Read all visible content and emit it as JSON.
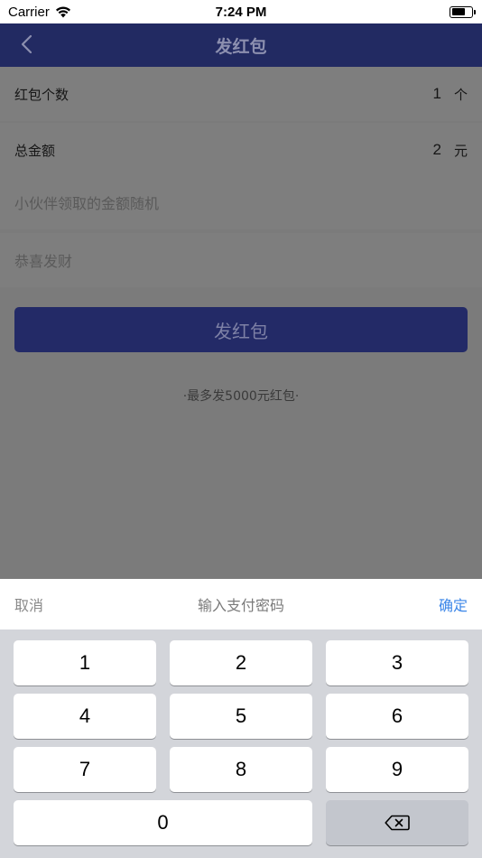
{
  "status_bar": {
    "carrier": "Carrier",
    "time": "7:24 PM"
  },
  "nav": {
    "title": "发红包"
  },
  "form": {
    "count_label": "红包个数",
    "count_value": "1",
    "count_unit": "个",
    "amount_label": "总金额",
    "amount_value": "2",
    "amount_unit": "元",
    "random_hint": "小伙伴领取的金额随机",
    "greeting_placeholder": "恭喜发财"
  },
  "send_button_label": "发红包",
  "max_note": "·最多发5000元红包·",
  "password_sheet": {
    "cancel": "取消",
    "title": "输入支付密码",
    "confirm": "确定"
  },
  "keypad": {
    "keys": [
      "1",
      "2",
      "3",
      "4",
      "5",
      "6",
      "7",
      "8",
      "9",
      "0"
    ]
  }
}
